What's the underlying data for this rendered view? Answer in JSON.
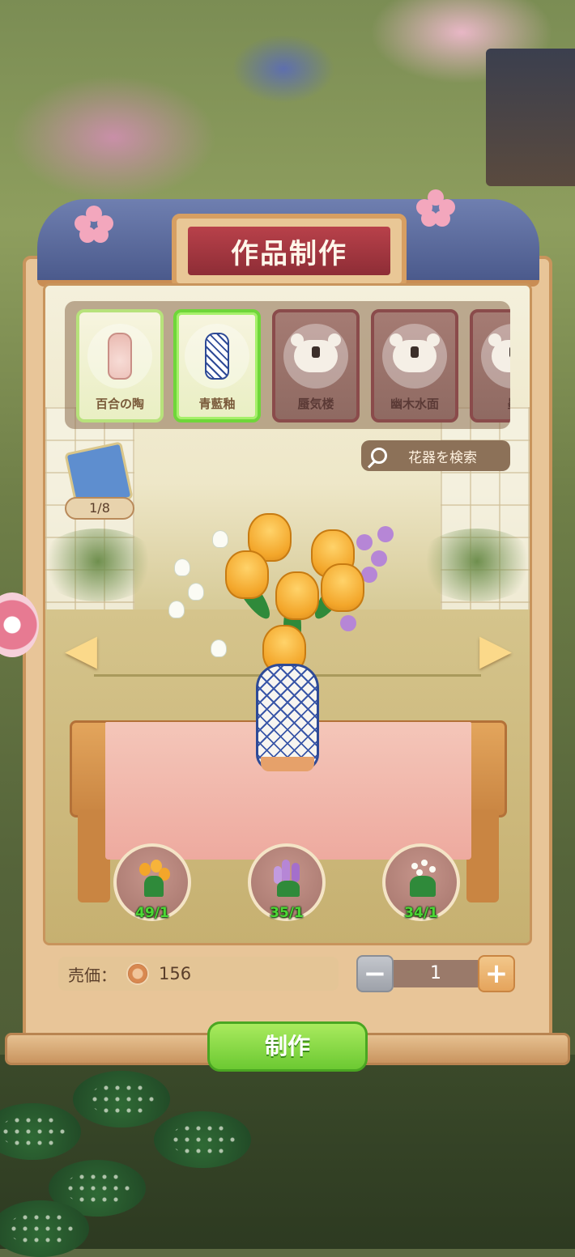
{
  "title": "作品制作",
  "vases": [
    {
      "name": "百合の陶",
      "state": "unlocked",
      "icon": "lily-vase-icon",
      "color": "#f1c9c3"
    },
    {
      "name": "青藍釉",
      "state": "selected",
      "icon": "blue-white-vase-icon",
      "color": "#2e4a96"
    },
    {
      "name": "蜃気楼",
      "state": "locked",
      "icon": "locked-vase-icon"
    },
    {
      "name": "幽木水面",
      "state": "locked",
      "icon": "locked-vase-icon"
    },
    {
      "name": "墨",
      "state": "locked",
      "icon": "locked-vase-icon"
    }
  ],
  "search": {
    "placeholder": "花器を検索",
    "icon": "search-icon"
  },
  "collection": {
    "count": "1/8",
    "icon": "book-icon"
  },
  "ingredients": [
    {
      "name": "tulip",
      "count": "49/1",
      "color": "#f3a62a"
    },
    {
      "name": "lilac",
      "count": "35/1",
      "color": "#b686d6"
    },
    {
      "name": "lily-of-the-valley",
      "count": "34/1",
      "color": "#fbfbf4"
    }
  ],
  "price": {
    "label": "売価：",
    "value": "156",
    "icon": "coin-icon"
  },
  "quantity": {
    "value": "1",
    "minus": "−",
    "plus": "+"
  },
  "make_button": "制作",
  "arrows": {
    "left": "◀",
    "right": "▶"
  },
  "colors": {
    "accent_green": "#6fd63a",
    "title_red": "#a6363f",
    "frame_wood": "#e8c598"
  }
}
